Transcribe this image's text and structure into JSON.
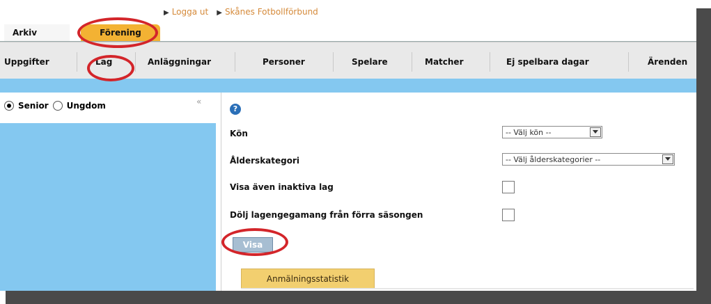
{
  "top_links": [
    {
      "label": "Logga ut"
    },
    {
      "label": "Skånes Fotbollförbund"
    }
  ],
  "tabs": [
    {
      "label": "Arkiv"
    },
    {
      "label": "Förening"
    }
  ],
  "nav": [
    {
      "label": "Uppgifter"
    },
    {
      "label": "Lag"
    },
    {
      "label": "Anläggningar"
    },
    {
      "label": "Personer"
    },
    {
      "label": "Spelare"
    },
    {
      "label": "Matcher"
    },
    {
      "label": "Ej spelbara dagar"
    },
    {
      "label": "Ärenden"
    }
  ],
  "sidebar": {
    "senior_label": "Senior",
    "ungdom_label": "Ungdom",
    "collapse_icon": "«"
  },
  "form": {
    "help_icon": "?",
    "kon_label": "Kön",
    "kon_select": "-- Välj kön --",
    "alder_label": "Ålderskategori",
    "alder_select": "-- Välj ålderskategorier --",
    "inaktiva_label": "Visa även inaktiva lag",
    "dolj_label": "Dölj lagengegamang från förra säsongen",
    "visa_button": "Visa",
    "stat_tab": "Anmälningsstatistik"
  },
  "colors": {
    "accent_orange": "#f3b233",
    "sidebar_blue": "#84c8f0",
    "highlight_red": "#d3252a"
  }
}
